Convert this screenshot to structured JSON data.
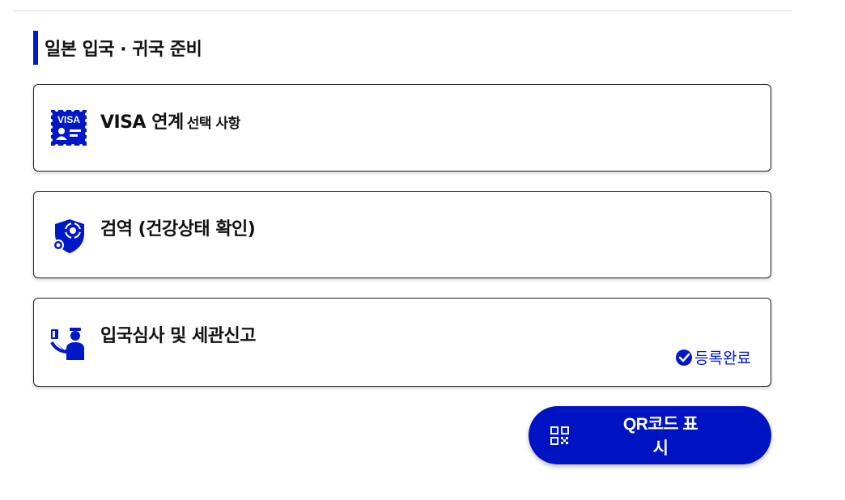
{
  "section": {
    "title": "일본 입국 · 귀국 준비"
  },
  "cards": {
    "visa": {
      "title": "VISA 연계",
      "subtitle": "선택 사항",
      "icon": "visa-icon"
    },
    "quarantine": {
      "title": "검역 (건강상태 확인)",
      "icon": "shield-gear-icon"
    },
    "immigration": {
      "title": "입국심사 및 세관신고",
      "icon": "officer-icon",
      "status": "등록완료"
    }
  },
  "qr_button": {
    "label": "QR코드 표시",
    "icon": "qr-code-icon"
  },
  "colors": {
    "accent": "#0018c8",
    "button": "#0014c4",
    "border": "#222222"
  }
}
